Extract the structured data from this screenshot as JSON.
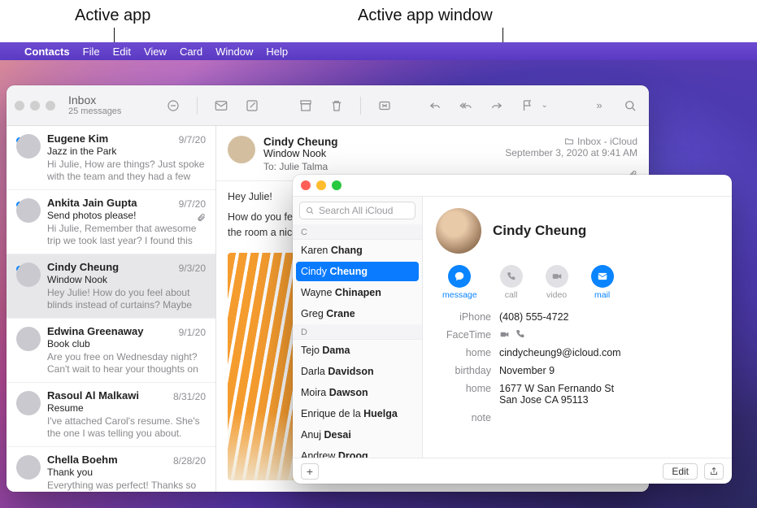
{
  "annotations": {
    "active_app": "Active app",
    "active_window": "Active app window"
  },
  "menubar": {
    "app": "Contacts",
    "items": [
      "File",
      "Edit",
      "View",
      "Card",
      "Window",
      "Help"
    ]
  },
  "mail": {
    "title": "Inbox",
    "subtitle": "25 messages",
    "header": {
      "from": "Cindy Cheung",
      "subject": "Window Nook",
      "to_label": "To:",
      "to": "Julie Talma",
      "folder": "Inbox - iCloud",
      "date": "September 3, 2020 at 9:41 AM"
    },
    "body_lines": [
      "Hey Julie!",
      "How do you feel about blinds instead of curtains? Maybe a yellow or orange color to give the room a nice pop? I think it could look GREAT"
    ],
    "messages": [
      {
        "sender": "Eugene Kim",
        "date": "9/7/20",
        "subject": "Jazz in the Park",
        "preview": "Hi Julie, How are things? Just spoke with the team and they had a few co…",
        "unread": true
      },
      {
        "sender": "Ankita Jain Gupta",
        "date": "9/7/20",
        "subject": "Send photos please!",
        "preview": "Hi Julie, Remember that awesome trip we took last year? I found this pictur…",
        "unread": true,
        "attach": true
      },
      {
        "sender": "Cindy Cheung",
        "date": "9/3/20",
        "subject": "Window Nook",
        "preview": "Hey Julie! How do you feel about blinds instead of curtains? Maybe a…",
        "unread": true,
        "selected": true
      },
      {
        "sender": "Edwina Greenaway",
        "date": "9/1/20",
        "subject": "Book club",
        "preview": "Are you free on Wednesday night? Can't wait to hear your thoughts on t…"
      },
      {
        "sender": "Rasoul Al Malkawi",
        "date": "8/31/20",
        "subject": "Resume",
        "preview": "I've attached Carol's resume. She's the one I was telling you about. She…"
      },
      {
        "sender": "Chella Boehm",
        "date": "8/28/20",
        "subject": "Thank you",
        "preview": "Everything was perfect! Thanks so much for helping out. The day was a…"
      }
    ]
  },
  "contacts": {
    "search_placeholder": "Search All iCloud",
    "groups": [
      {
        "letter": "C",
        "items": [
          "Karen Chang",
          "Cindy Cheung",
          "Wayne Chinapen",
          "Greg Crane"
        ]
      },
      {
        "letter": "D",
        "items": [
          "Tejo Dama",
          "Darla Davidson",
          "Moira Dawson",
          "Enrique de la Huelga",
          "Anuj Desai",
          "Andrew Droog"
        ]
      }
    ],
    "selected": "Cindy Cheung",
    "card": {
      "name": "Cindy Cheung",
      "actions": {
        "message": "message",
        "call": "call",
        "video": "video",
        "mail": "mail"
      },
      "fields": [
        {
          "label": "iPhone",
          "value": "(408) 555-4722"
        },
        {
          "label": "FaceTime",
          "value": "",
          "icons": true
        },
        {
          "label": "home",
          "value": "cindycheung9@icloud.com"
        },
        {
          "label": "birthday",
          "value": "November 9"
        },
        {
          "label": "home",
          "value": "1677 W San Fernando St\nSan Jose CA 95113"
        },
        {
          "label": "note",
          "value": ""
        }
      ]
    },
    "buttons": {
      "edit": "Edit"
    }
  }
}
